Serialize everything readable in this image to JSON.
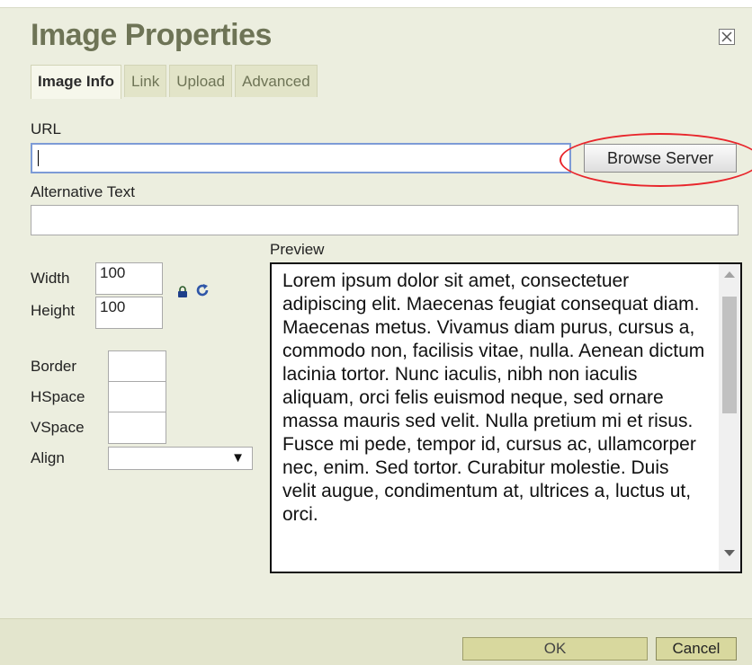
{
  "dialog": {
    "title": "Image Properties",
    "close_icon": "close-icon"
  },
  "tabs": [
    {
      "label": "Image Info",
      "active": true
    },
    {
      "label": "Link",
      "active": false
    },
    {
      "label": "Upload",
      "active": false
    },
    {
      "label": "Advanced",
      "active": false
    }
  ],
  "image_info": {
    "url_label": "URL",
    "url_value": "",
    "browse_button": "Browse Server",
    "alt_label": "Alternative Text",
    "alt_value": "",
    "width_label": "Width",
    "width_value": "100",
    "height_label": "Height",
    "height_value": "100",
    "lock_icon": "lock-icon",
    "reset_icon": "refresh-icon",
    "border_label": "Border",
    "border_value": "",
    "hspace_label": "HSpace",
    "hspace_value": "",
    "vspace_label": "VSpace",
    "vspace_value": "",
    "align_label": "Align",
    "align_value": "",
    "preview_label": "Preview",
    "preview_text": "Lorem ipsum dolor sit amet, consectetuer adipiscing elit. Maecenas feugiat consequat diam. Maecenas metus. Vivamus diam purus, cursus a, commodo non, facilisis vitae, nulla. Aenean dictum lacinia tortor. Nunc iaculis, nibh non iaculis aliquam, orci felis euismod neque, sed ornare massa mauris sed velit. Nulla pretium mi et risus. Fusce mi pede, tempor id, cursus ac, ullamcorper nec, enim. Sed tortor. Curabitur molestie. Duis velit augue, condimentum at, ultrices a, luctus ut, orci."
  },
  "footer": {
    "ok_label": "OK",
    "cancel_label": "Cancel"
  },
  "colors": {
    "highlight": "#e8262c",
    "title": "#6e7456",
    "background": "#eceedf"
  }
}
